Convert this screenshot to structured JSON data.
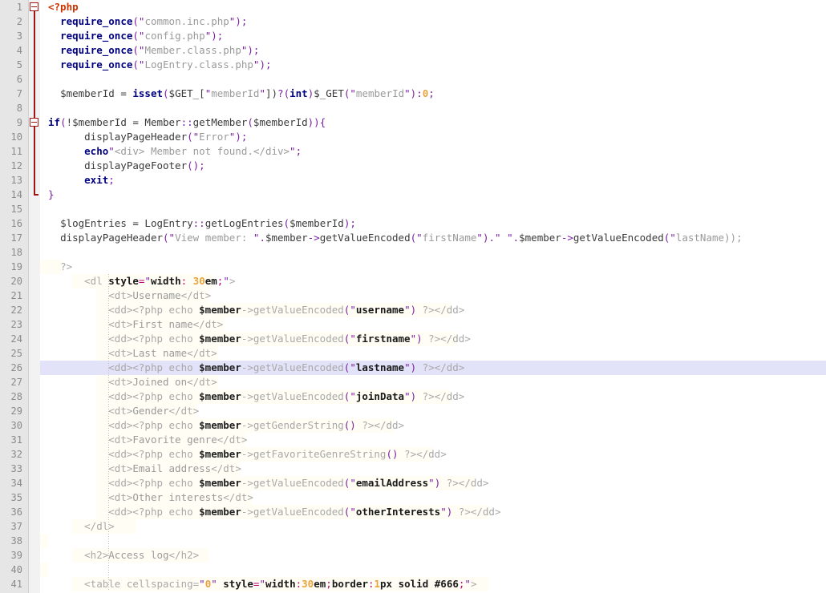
{
  "editor": {
    "language": "PHP",
    "total_lines_visible": 41,
    "current_line": 26,
    "line_number_start": 1,
    "colors": {
      "background": "#ffffff",
      "gutter_background": "#e6e6e6",
      "line_number": "#8a8a8a",
      "current_line_highlight": "#e2e2f8",
      "html_block_background": "#fffdf4",
      "fold_marker": "#a01414",
      "keyword": "#000080",
      "php_open_tag": "#cc3300",
      "string": "#9a9a9a",
      "punctuation": "#7a1fa0",
      "number": "#e8a33d",
      "html_tag": "#a8a8a8",
      "attribute_equals": "#c2007a"
    },
    "fold_markers": [
      {
        "line": 1,
        "type": "collapse-box",
        "icon": "fold-minus-icon"
      },
      {
        "line": 9,
        "type": "collapse-box",
        "icon": "fold-minus-icon"
      },
      {
        "line": 14,
        "type": "fold-end",
        "icon": "fold-end-icon"
      }
    ],
    "lines": [
      {
        "n": 1,
        "html": "<span class=\"phptag\">&lt;?php</span>",
        "text": "<?php",
        "bg": "none"
      },
      {
        "n": 2,
        "html": "  <span class=\"kw\">require_once</span><span class=\"pun\">(</span><span class=\"strq\">\"</span><span class=\"str\">common.inc.php</span><span class=\"strq\">\"</span><span class=\"pun\">);</span>",
        "text": "  require_once(\"common.inc.php\");",
        "bg": "none"
      },
      {
        "n": 3,
        "html": "  <span class=\"kw\">require_once</span><span class=\"pun\">(</span><span class=\"strq\">\"</span><span class=\"str\">config.php</span><span class=\"strq\">\"</span><span class=\"pun\">);</span>",
        "text": "  require_once(\"config.php\");",
        "bg": "none"
      },
      {
        "n": 4,
        "html": "  <span class=\"kw\">require_once</span><span class=\"pun\">(</span><span class=\"strq\">\"</span><span class=\"str\">Member.class.php</span><span class=\"strq\">\"</span><span class=\"pun\">);</span>",
        "text": "  require_once(\"Member.class.php\");",
        "bg": "none"
      },
      {
        "n": 5,
        "html": "  <span class=\"kw\">require_once</span><span class=\"pun\">(</span><span class=\"strq\">\"</span><span class=\"str\">LogEntry.class.php</span><span class=\"strq\">\"</span><span class=\"pun\">);</span>",
        "text": "  require_once(\"LogEntry.class.php\");",
        "bg": "none"
      },
      {
        "n": 6,
        "html": "",
        "text": "",
        "bg": "none"
      },
      {
        "n": 7,
        "html": "  <span class=\"plain\">$memberId = </span><span class=\"kw\">isset</span><span class=\"pun\">(</span><span class=\"plain\">$GET_[</span><span class=\"strq\">\"</span><span class=\"str\">memberId</span><span class=\"strq\">\"</span><span class=\"plain\">])</span><span class=\"pun\">?(</span><span class=\"kw\">int</span><span class=\"pun\">)</span><span class=\"plain\">$_GET</span><span class=\"pun\">(</span><span class=\"strq\">\"</span><span class=\"str\">memberId</span><span class=\"strq\">\"</span><span class=\"pun\">):</span><span class=\"num\">0</span><span class=\"pun\">;</span>",
        "text": "  $memberId = isset($GET_[\"memberId\"])?(int)$_GET(\"memberId\"):0;",
        "bg": "none"
      },
      {
        "n": 8,
        "html": "",
        "text": "",
        "bg": "none"
      },
      {
        "n": 9,
        "html": "<span class=\"kw\">if</span><span class=\"pun\">(</span><span class=\"plain\">!$memberId = Member</span><span class=\"pun\">::</span><span class=\"plain\">getMember</span><span class=\"pun\">(</span><span class=\"plain\">$memberId</span><span class=\"pun\">)){</span>",
        "text": "if(!$memberId = Member::getMember($memberId)){",
        "bg": "none"
      },
      {
        "n": 10,
        "html": "      <span class=\"plain\">displayPageHeader</span><span class=\"pun\">(</span><span class=\"strq\">\"</span><span class=\"str\">Error</span><span class=\"strq\">\"</span><span class=\"pun\">);</span>",
        "text": "      displayPageHeader(\"Error\");",
        "bg": "none"
      },
      {
        "n": 11,
        "html": "      <span class=\"kw\">echo</span><span class=\"strq\">\"</span><span class=\"str\">&lt;div&gt; Member not found.&lt;/div&gt;</span><span class=\"strq\">\"</span><span class=\"pun\">;</span>",
        "text": "      echo\"<div> Member not found.</div>\";",
        "bg": "none"
      },
      {
        "n": 12,
        "html": "      <span class=\"plain\">displayPageFooter</span><span class=\"pun\">();</span>",
        "text": "      displayPageFooter();",
        "bg": "none"
      },
      {
        "n": 13,
        "html": "      <span class=\"kw\">exit</span><span class=\"pun\">;</span>",
        "text": "      exit;",
        "bg": "none"
      },
      {
        "n": 14,
        "html": "<span class=\"pun\">}</span>",
        "text": "}",
        "bg": "none"
      },
      {
        "n": 15,
        "html": "",
        "text": "",
        "bg": "none"
      },
      {
        "n": 16,
        "html": "  <span class=\"plain\">$logEntries = LogEntry</span><span class=\"pun\">::</span><span class=\"plain\">getLogEntries</span><span class=\"pun\">(</span><span class=\"plain\">$memberId</span><span class=\"pun\">);</span>",
        "text": "  $logEntries = LogEntry::getLogEntries($memberId);",
        "bg": "none"
      },
      {
        "n": 17,
        "html": "  <span class=\"plain\">displayPageHeader</span><span class=\"pun\">(</span><span class=\"strq\">\"</span><span class=\"str\">View member: </span><span class=\"strq\">\"</span><span class=\"pun\">.</span><span class=\"plain\">$member</span><span class=\"pun\">-&gt;</span><span class=\"plain\">getValueEncoded</span><span class=\"pun\">(</span><span class=\"strq\">\"</span><span class=\"str\">firstName</span><span class=\"strq\">\"</span><span class=\"pun\">).</span><span class=\"strq\">\"</span><span class=\"str\"> </span><span class=\"strq\">\"</span><span class=\"pun\">.</span><span class=\"plain\">$member</span><span class=\"pun\">-&gt;</span><span class=\"plain\">getValueEncoded</span><span class=\"pun\">(</span><span class=\"strq\">\"</span><span class=\"str\">lastName));</span>",
        "text": "  displayPageHeader(\"View member: \".$member->getValueEncoded(\"firstName\").\" \".$member->getValueEncoded(\"lastName));",
        "bg": "none"
      },
      {
        "n": 18,
        "html": "",
        "text": "",
        "bg": "none"
      },
      {
        "n": 19,
        "html": "  <span class=\"htag\">?&gt;</span>",
        "text": "  ?>",
        "bg": "cream",
        "bgx": 0,
        "bgw": 28
      },
      {
        "n": 20,
        "html": "      <span class=\"htag\">&lt;dl </span><span class=\"attr\">style</span><span class=\"eq\">=</span><span class=\"strq\">\"</span><span class=\"attr\">width</span><span class=\"eq\">: </span><span class=\"num\">30</span><span class=\"attr\">em</span><span class=\"eq\">;</span><span class=\"strq\">\"</span><span class=\"htag\">&gt;</span>",
        "text": "      <dl style=\"width: 30em;\">",
        "bg": "cream",
        "bgx": 40,
        "bgw": 176
      },
      {
        "n": 21,
        "html": "          <span class=\"htag\">&lt;dt&gt;</span><span class=\"htagtxt\">Username</span><span class=\"htag\">&lt;/dt&gt;</span>",
        "text": "          <dt>Username</dt>",
        "bg": "cream",
        "bgx": 70,
        "bgw": 140
      },
      {
        "n": 22,
        "html": "          <span class=\"htag\">&lt;dd&gt;&lt;?php echo </span><span class=\"var\">$member</span><span class=\"htag\">-&gt;getValueEncoded</span><span class=\"pun\">(</span><span class=\"strq\">\"</span><span class=\"attr\">username</span><span class=\"strq\">\"</span><span class=\"pun\">)</span><span class=\"htag\"> ?&gt;&lt;/dd&gt;</span>",
        "text": "          <dd><?php echo $member->getValueEncoded(\"username\") ?></dd>",
        "bg": "cream",
        "bgx": 70,
        "bgw": 442
      },
      {
        "n": 23,
        "html": "          <span class=\"htag\">&lt;dt&gt;</span><span class=\"htagtxt\">First name</span><span class=\"htag\">&lt;/dt&gt;</span>",
        "text": "          <dt>First name</dt>",
        "bg": "cream",
        "bgx": 70,
        "bgw": 160
      },
      {
        "n": 24,
        "html": "          <span class=\"htag\">&lt;dd&gt;&lt;?php echo </span><span class=\"var\">$member</span><span class=\"htag\">-&gt;getValueEncoded</span><span class=\"pun\">(</span><span class=\"strq\">\"</span><span class=\"attr\">firstname</span><span class=\"strq\">\"</span><span class=\"pun\">)</span><span class=\"htag\"> ?&gt;&lt;/dd&gt;</span>",
        "text": "          <dd><?php echo $member->getValueEncoded(\"firstname\") ?></dd>",
        "bg": "cream",
        "bgx": 70,
        "bgw": 450
      },
      {
        "n": 25,
        "html": "          <span class=\"htag\">&lt;dt&gt;</span><span class=\"htagtxt\">Last name</span><span class=\"htag\">&lt;/dt&gt;</span>",
        "text": "          <dt>Last name</dt>",
        "bg": "cream",
        "bgx": 70,
        "bgw": 152
      },
      {
        "n": 26,
        "html": "          <span class=\"htag\">&lt;dd&gt;&lt;?php echo </span><span class=\"var\">$member</span><span class=\"htag\">-&gt;getValueEncoded</span><span class=\"pun\">(</span><span class=\"strq\">\"</span><span class=\"attr\">lastname</span><span class=\"strq\">\"</span><span class=\"pun\">)</span><span class=\"htag\"> ?&gt;&lt;/dd&gt;</span>",
        "text": "          <dd><?php echo $member->getValueEncoded(\"lastname\") ?></dd>",
        "bg": "curline"
      },
      {
        "n": 27,
        "html": "          <span class=\"htag\">&lt;dt&gt;</span><span class=\"htagtxt\">Joined on</span><span class=\"htag\">&lt;/dt&gt;</span>",
        "text": "          <dt>Joined on</dt>",
        "bg": "cream",
        "bgx": 70,
        "bgw": 152
      },
      {
        "n": 28,
        "html": "          <span class=\"htag\">&lt;dd&gt;&lt;?php echo </span><span class=\"var\">$member</span><span class=\"htag\">-&gt;getValueEncoded</span><span class=\"pun\">(</span><span class=\"strq\">\"</span><span class=\"attr\">joinData</span><span class=\"strq\">\"</span><span class=\"pun\">)</span><span class=\"htag\"> ?&gt;&lt;/dd&gt;</span>",
        "text": "          <dd><?php echo $member->getValueEncoded(\"joinData\") ?></dd>",
        "bg": "cream",
        "bgx": 70,
        "bgw": 442
      },
      {
        "n": 29,
        "html": "          <span class=\"htag\">&lt;dt&gt;</span><span class=\"htagtxt\">Gender</span><span class=\"htag\">&lt;/dt&gt;</span>",
        "text": "          <dt>Gender</dt>",
        "bg": "cream",
        "bgx": 70,
        "bgw": 126
      },
      {
        "n": 30,
        "html": "          <span class=\"htag\">&lt;dd&gt;&lt;?php echo </span><span class=\"var\">$member</span><span class=\"htag\">-&gt;getGenderString</span><span class=\"pun\">()</span><span class=\"htag\"> ?&gt;&lt;/dd&gt;</span>",
        "text": "          <dd><?php echo $member->getGenderString() ?></dd>",
        "bg": "cream",
        "bgx": 70,
        "bgw": 372
      },
      {
        "n": 31,
        "html": "          <span class=\"htag\">&lt;dt&gt;</span><span class=\"htagtxt\">Favorite genre</span><span class=\"htag\">&lt;/dt&gt;</span>",
        "text": "          <dt>Favorite genre</dt>",
        "bg": "cream",
        "bgx": 70,
        "bgw": 186
      },
      {
        "n": 32,
        "html": "          <span class=\"htag\">&lt;dd&gt;&lt;?php echo </span><span class=\"var\">$member</span><span class=\"htag\">-&gt;getFavoriteGenreString</span><span class=\"pun\">()</span><span class=\"htag\"> ?&gt;&lt;/dd&gt;</span>",
        "text": "          <dd><?php echo $member->getFavoriteGenreString() ?></dd>",
        "bg": "cream",
        "bgx": 70,
        "bgw": 420
      },
      {
        "n": 33,
        "html": "          <span class=\"htag\">&lt;dt&gt;</span><span class=\"htagtxt\">Email address</span><span class=\"htag\">&lt;/dt&gt;</span>",
        "text": "          <dt>Email address</dt>",
        "bg": "cream",
        "bgx": 70,
        "bgw": 180
      },
      {
        "n": 34,
        "html": "          <span class=\"htag\">&lt;dd&gt;&lt;?php echo </span><span class=\"var\">$member</span><span class=\"htag\">-&gt;getValueEncoded</span><span class=\"pun\">(</span><span class=\"strq\">\"</span><span class=\"attr\">emailAddress</span><span class=\"strq\">\"</span><span class=\"pun\">)</span><span class=\"htag\"> ?&gt;&lt;/dd&gt;</span>",
        "text": "          <dd><?php echo $member->getValueEncoded(\"emailAddress\") ?></dd>",
        "bg": "cream",
        "bgx": 70,
        "bgw": 472
      },
      {
        "n": 35,
        "html": "          <span class=\"htag\">&lt;dt&gt;</span><span class=\"htagtxt\">Other interests</span><span class=\"htag\">&lt;/dt&gt;</span>",
        "text": "          <dt>Other interests</dt>",
        "bg": "cream",
        "bgx": 70,
        "bgw": 194
      },
      {
        "n": 36,
        "html": "          <span class=\"htag\">&lt;dd&gt;&lt;?php echo </span><span class=\"var\">$member</span><span class=\"htag\">-&gt;getValueEncoded</span><span class=\"pun\">(</span><span class=\"strq\">\"</span><span class=\"attr\">otherInterests</span><span class=\"strq\">\"</span><span class=\"pun\">)</span><span class=\"htag\"> ?&gt;&lt;/dd&gt;</span>",
        "text": "          <dd><?php echo $member->getValueEncoded(\"otherInterests\") ?></dd>",
        "bg": "cream",
        "bgx": 70,
        "bgw": 490
      },
      {
        "n": 37,
        "html": "      <span class=\"htag\">&lt;/dl&gt;</span>",
        "text": "      <dl>",
        "bg": "cream",
        "bgx": 40,
        "bgw": 80
      },
      {
        "n": 38,
        "html": "",
        "text": "",
        "bg": "cream",
        "bgx": 0,
        "bgw": 10
      },
      {
        "n": 39,
        "html": "      <span class=\"htag\">&lt;h2&gt;</span><span class=\"htagtxt\">Access log</span><span class=\"htag\">&lt;/h2&gt;</span>",
        "text": "      <h2>Access log</h2>",
        "bg": "cream",
        "bgx": 40,
        "bgw": 170
      },
      {
        "n": 40,
        "html": "",
        "text": "",
        "bg": "cream",
        "bgx": 0,
        "bgw": 10
      },
      {
        "n": 41,
        "html": "      <span class=\"htag\">&lt;table cellspacing=</span><span class=\"strq\">\"</span><span class=\"num\">0</span><span class=\"strq\">\"</span><span class=\"htag\"> </span><span class=\"attr\">style</span><span class=\"eq\">=</span><span class=\"strq\">\"</span><span class=\"attr\">width</span><span class=\"eq\">:</span><span class=\"num\">30</span><span class=\"attr\">em</span><span class=\"eq\">;</span><span class=\"attr\">border</span><span class=\"eq\">:</span><span class=\"num\">1</span><span class=\"attr\">px solid #666</span><span class=\"eq\">;</span><span class=\"strq\">\"</span><span class=\"htag\">&gt;</span>",
        "text": "      <table cellspacing=\"0\" style=\"width:30em;border:1px solid #666;\">",
        "bg": "cream",
        "bgx": 40,
        "bgw": 520
      }
    ],
    "indent_guides": [
      {
        "x": 85,
        "from_line": 20,
        "to_line": 41
      }
    ]
  }
}
